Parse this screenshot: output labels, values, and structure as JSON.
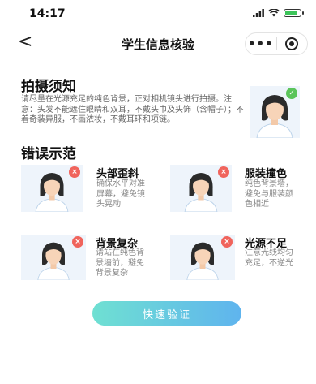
{
  "status_bar": {
    "time": "14:17"
  },
  "nav": {
    "back_symbol": "<",
    "title": "学生信息核验",
    "more_symbol": "•••"
  },
  "notice": {
    "title": "拍摄须知",
    "text": "请尽量在光源充足的纯色背景，正对相机镜头进行拍摄。注意：头发不能遮住眼睛和双耳，不戴头巾及头饰（含帽子）；不着奇装异服，不画浓妆，不戴耳环和项链。",
    "sample_badge": "✓"
  },
  "errors": {
    "title": "错误示范",
    "items": [
      {
        "title": "头部歪斜",
        "desc": "确保水平对准屏幕，避免镜头晃动",
        "badge": "×"
      },
      {
        "title": "服装撞色",
        "desc": "纯色背景墙，避免与服装颜色相近",
        "badge": "×"
      },
      {
        "title": "背景复杂",
        "desc": "请站在纯色背景墙前，避免背景复杂",
        "badge": "×"
      },
      {
        "title": "光源不足",
        "desc": "注意光线均匀充足，不逆光",
        "badge": "×"
      }
    ]
  },
  "action": {
    "verify_label": "快速验证"
  },
  "colors": {
    "accent_start": "#6fe0d2",
    "accent_end": "#5fb4ee",
    "ok": "#5bc45b",
    "error": "#f0645c"
  },
  "icons": [
    "back-icon",
    "more-icon",
    "close-icon",
    "check-icon",
    "error-icon",
    "signal-icon",
    "wifi-icon",
    "battery-icon"
  ]
}
